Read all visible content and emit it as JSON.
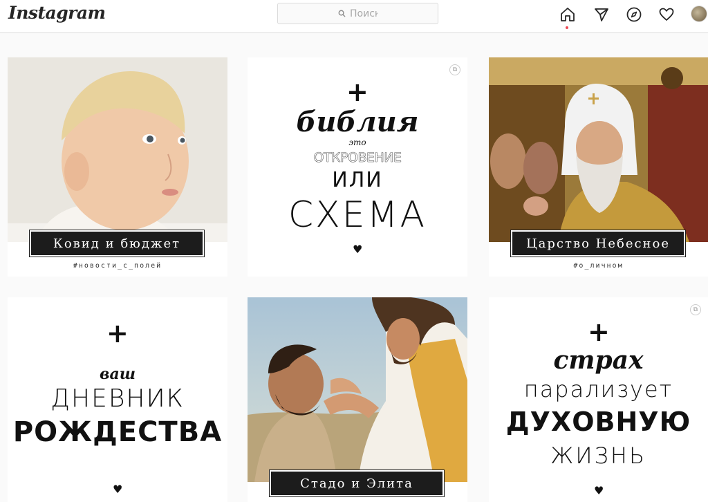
{
  "header": {
    "logo": "Instagram",
    "search_placeholder": "Поиск",
    "icons": [
      "home-icon",
      "direct-icon",
      "explore-icon",
      "activity-heart-icon",
      "profile-avatar"
    ],
    "notification_dot_color": "#ed4956"
  },
  "posts": [
    {
      "label": "Ковид и бюджет",
      "hashtag": "#новости_с_полей",
      "image": "baby-photo"
    },
    {
      "lines": [
        "библия",
        "это",
        "ОТКРОВЕНИЕ",
        "ИЛИ",
        "СХЕМА"
      ],
      "cross": "+",
      "heart": "♥"
    },
    {
      "label": "Царство Небесное",
      "hashtag": "#о_личном",
      "image": "bishop-photo"
    },
    {
      "lines": [
        "ваш",
        "ДНЕВНИК",
        "РОЖДЕСТВА"
      ],
      "cross": "+",
      "heart": "♥"
    },
    {
      "label": "Стадо и Элита",
      "image": "jesus-healing-painting"
    },
    {
      "lines": [
        "страх",
        "парализует",
        "ДУХОВНУЮ",
        "ЖИЗНЬ"
      ],
      "cross": "+",
      "heart": "♥"
    }
  ]
}
